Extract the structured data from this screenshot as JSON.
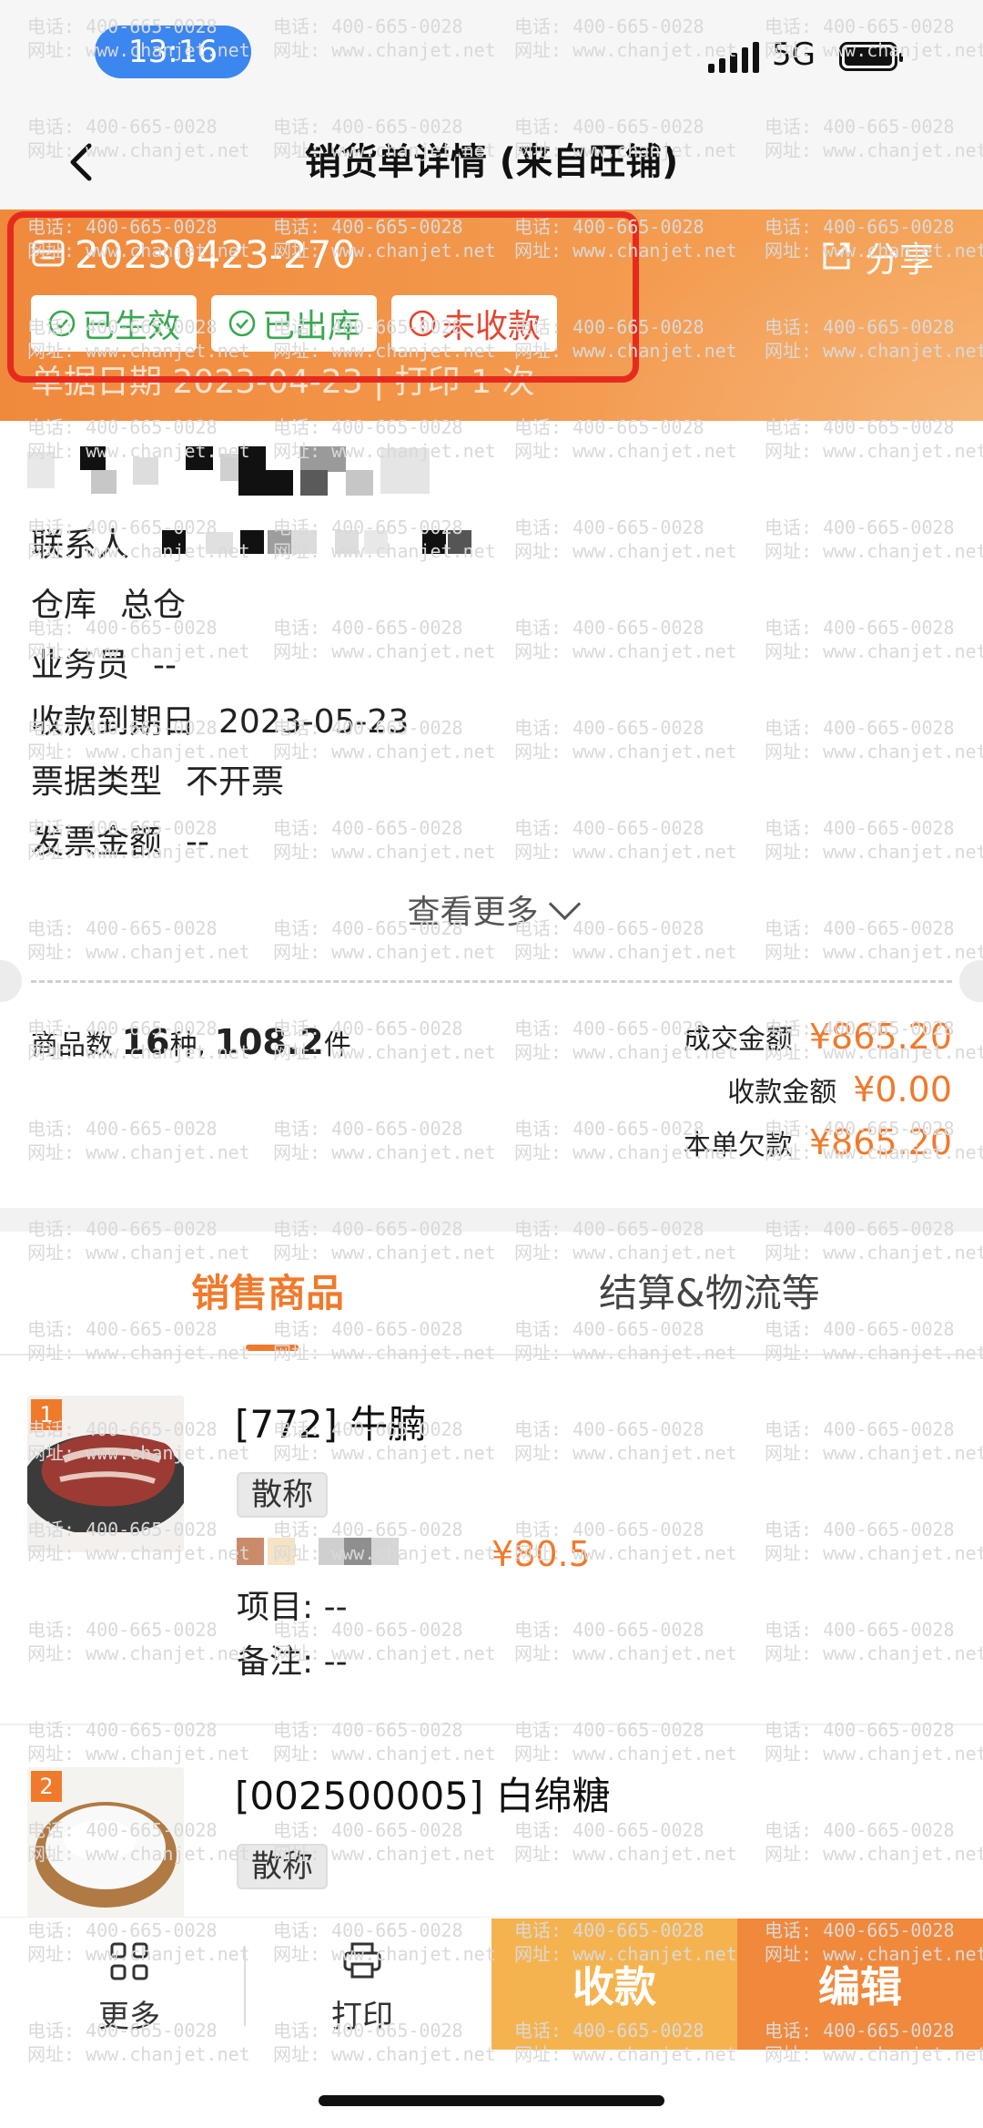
{
  "status_bar": {
    "time": "13:16",
    "network": "5G"
  },
  "nav": {
    "title": "销货单详情 (来自旺铺)"
  },
  "header": {
    "order_no": "20230423-270",
    "share_label": "分享",
    "badges": [
      "已生效",
      "已出库",
      "未收款"
    ],
    "date_line": "单据日期 2023-04-23 | 打印 1 次",
    "colors": {
      "gradient_start": "#f0893c",
      "gradient_end": "#f5a55a",
      "highlight_box": "#e62b1e"
    }
  },
  "info": {
    "contact_label": "联系人",
    "warehouse_label": "仓库",
    "warehouse_value": "总仓",
    "salesman_label": "业务员",
    "salesman_value": "--",
    "due_label": "收款到期日",
    "due_value": "2023-05-23",
    "invoice_type_label": "票据类型",
    "invoice_type_value": "不开票",
    "invoice_amount_label": "发票金额",
    "invoice_amount_value": "--",
    "see_more": "查看更多"
  },
  "summary": {
    "count_label": "商品数",
    "kinds": "16",
    "kinds_unit": "种,",
    "pieces": "108.2",
    "pieces_unit": "件",
    "deal_label": "成交金额",
    "deal_value": "¥865.20",
    "received_label": "收款金额",
    "received_value": "¥0.00",
    "owed_label": "本单欠款",
    "owed_value": "¥865.20"
  },
  "tabs": {
    "active": "销售商品",
    "inactive": "结算&物流等"
  },
  "products": [
    {
      "index": "1",
      "name": "[772] 牛腩",
      "tag": "散称",
      "price": "¥80.5",
      "project": "项目: --",
      "remark": "备注: --"
    },
    {
      "index": "2",
      "name": "[002500005] 白绵糖",
      "tag": "散称"
    }
  ],
  "bottom_bar": {
    "more": "更多",
    "print": "打印",
    "collect": "收款",
    "edit": "编辑"
  },
  "watermark": {
    "phone": "电话: 400-665-0028",
    "site": "网址: www.chanjet.net"
  },
  "accent_color": "#f07a2c"
}
